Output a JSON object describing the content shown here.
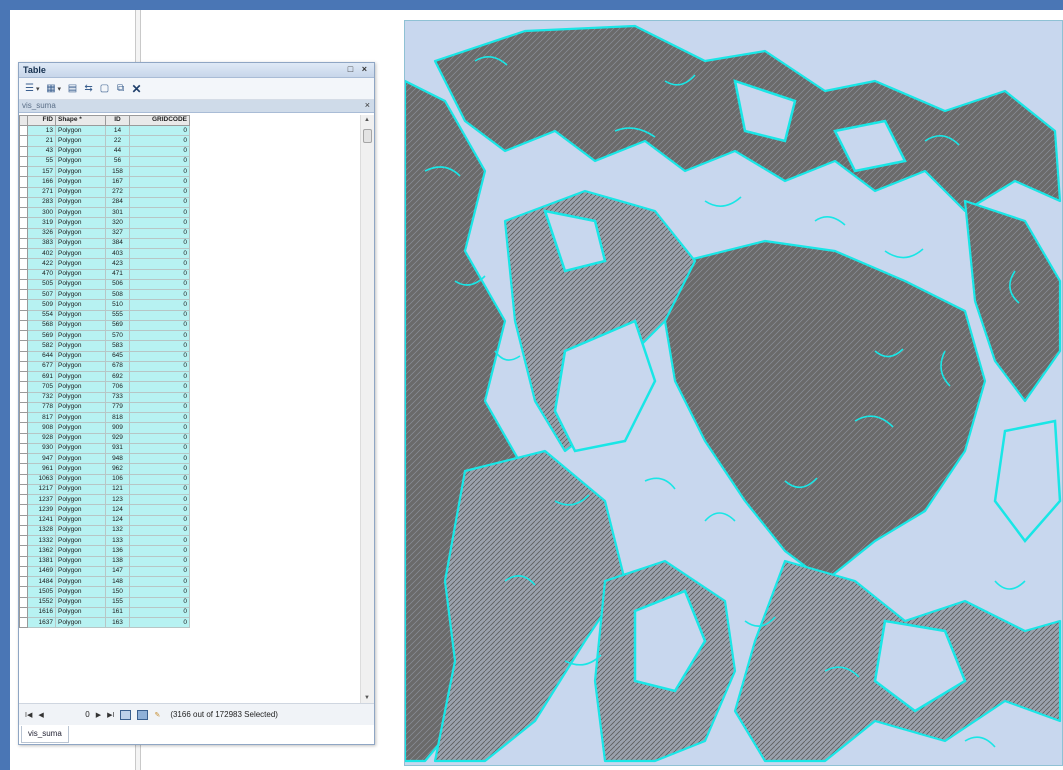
{
  "table_window": {
    "title": "Table",
    "controls": "□ ×",
    "layer_tab": "vis_suma",
    "layer_tab_close": "×",
    "columns": [
      "FID",
      "Shape *",
      "ID",
      "GRIDCODE"
    ],
    "rows": [
      [
        "13",
        "Polygon",
        "14",
        "0"
      ],
      [
        "21",
        "Polygon",
        "22",
        "0"
      ],
      [
        "43",
        "Polygon",
        "44",
        "0"
      ],
      [
        "55",
        "Polygon",
        "56",
        "0"
      ],
      [
        "157",
        "Polygon",
        "158",
        "0"
      ],
      [
        "166",
        "Polygon",
        "167",
        "0"
      ],
      [
        "271",
        "Polygon",
        "272",
        "0"
      ],
      [
        "283",
        "Polygon",
        "284",
        "0"
      ],
      [
        "300",
        "Polygon",
        "301",
        "0"
      ],
      [
        "319",
        "Polygon",
        "320",
        "0"
      ],
      [
        "326",
        "Polygon",
        "327",
        "0"
      ],
      [
        "383",
        "Polygon",
        "384",
        "0"
      ],
      [
        "402",
        "Polygon",
        "403",
        "0"
      ],
      [
        "422",
        "Polygon",
        "423",
        "0"
      ],
      [
        "470",
        "Polygon",
        "471",
        "0"
      ],
      [
        "505",
        "Polygon",
        "506",
        "0"
      ],
      [
        "507",
        "Polygon",
        "508",
        "0"
      ],
      [
        "509",
        "Polygon",
        "510",
        "0"
      ],
      [
        "554",
        "Polygon",
        "555",
        "0"
      ],
      [
        "568",
        "Polygon",
        "569",
        "0"
      ],
      [
        "569",
        "Polygon",
        "570",
        "0"
      ],
      [
        "582",
        "Polygon",
        "583",
        "0"
      ],
      [
        "644",
        "Polygon",
        "645",
        "0"
      ],
      [
        "677",
        "Polygon",
        "678",
        "0"
      ],
      [
        "691",
        "Polygon",
        "692",
        "0"
      ],
      [
        "705",
        "Polygon",
        "706",
        "0"
      ],
      [
        "732",
        "Polygon",
        "733",
        "0"
      ],
      [
        "778",
        "Polygon",
        "779",
        "0"
      ],
      [
        "817",
        "Polygon",
        "818",
        "0"
      ],
      [
        "908",
        "Polygon",
        "909",
        "0"
      ],
      [
        "928",
        "Polygon",
        "929",
        "0"
      ],
      [
        "930",
        "Polygon",
        "931",
        "0"
      ],
      [
        "947",
        "Polygon",
        "948",
        "0"
      ],
      [
        "961",
        "Polygon",
        "962",
        "0"
      ],
      [
        "1063",
        "Polygon",
        "106",
        "0"
      ],
      [
        "1217",
        "Polygon",
        "121",
        "0"
      ],
      [
        "1237",
        "Polygon",
        "123",
        "0"
      ],
      [
        "1239",
        "Polygon",
        "124",
        "0"
      ],
      [
        "1241",
        "Polygon",
        "124",
        "0"
      ],
      [
        "1328",
        "Polygon",
        "132",
        "0"
      ],
      [
        "1332",
        "Polygon",
        "133",
        "0"
      ],
      [
        "1362",
        "Polygon",
        "136",
        "0"
      ],
      [
        "1381",
        "Polygon",
        "138",
        "0"
      ],
      [
        "1469",
        "Polygon",
        "147",
        "0"
      ],
      [
        "1484",
        "Polygon",
        "148",
        "0"
      ],
      [
        "1505",
        "Polygon",
        "150",
        "0"
      ],
      [
        "1552",
        "Polygon",
        "155",
        "0"
      ],
      [
        "1616",
        "Polygon",
        "161",
        "0"
      ],
      [
        "1637",
        "Polygon",
        "163",
        "0"
      ]
    ],
    "nav": {
      "first": "I◀",
      "prev": "◀",
      "record": "0",
      "next": "▶",
      "last": "▶I",
      "selected_status": "(3166 out of 172983 Selected)"
    },
    "bottom_tab": "vis_suma"
  },
  "colors": {
    "background": "#4a76b5",
    "selected_row": "#b7f2f2",
    "map_land": "#c8d7ee",
    "map_dense": "#5b5b5b",
    "map_outline": "#19e6e6"
  }
}
